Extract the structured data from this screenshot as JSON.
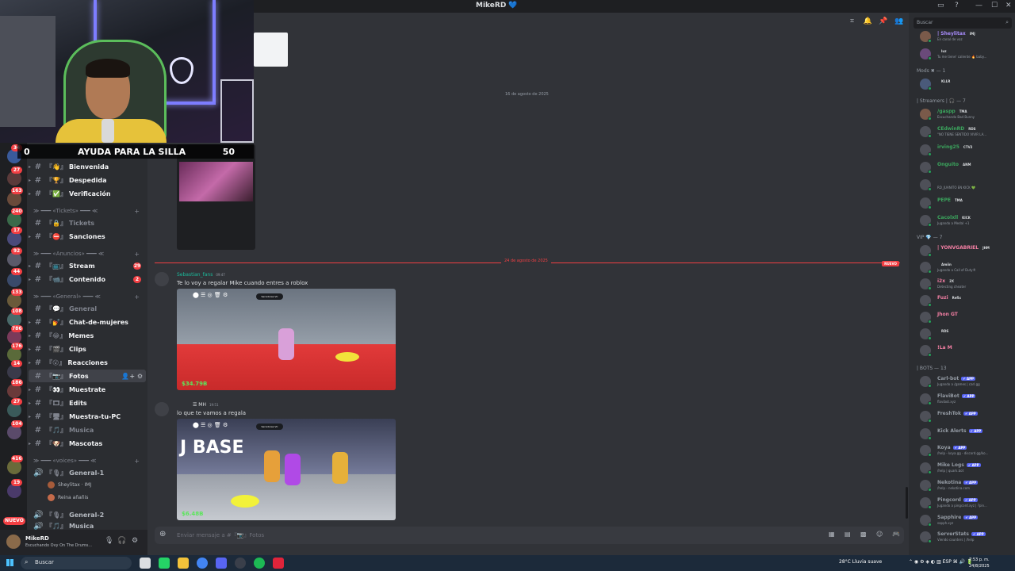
{
  "window": {
    "title": "MikeRD",
    "heart": "💙",
    "controls": [
      "▭",
      "?",
      "—",
      "☐",
      "✕"
    ]
  },
  "overlay": {
    "left_count": "0",
    "goal_text": "AYUDA PARA LA SILLA",
    "right_count": "50"
  },
  "rail": {
    "badges": [
      "34",
      "27",
      "163",
      "240",
      "17",
      "92",
      "44",
      "133",
      "108",
      "786",
      "176",
      "14",
      "186",
      "27",
      "104",
      "416",
      "19"
    ],
    "nuevo": "NUEVO"
  },
  "sidebar": {
    "channels": [
      {
        "label": "Bienvenida",
        "deco": "『👋』",
        "muted": false
      },
      {
        "label": "Despedida",
        "deco": "『🏆』",
        "muted": false
      },
      {
        "label": "Verificación",
        "deco": "『✅』",
        "muted": false
      },
      {
        "label": "Tickets",
        "deco": "『🔒』",
        "muted": true
      },
      {
        "label": "Sanciones",
        "deco": "『⛔』",
        "muted": false
      },
      {
        "label": "Stream",
        "deco": "『📺』",
        "muted": false,
        "badge": "29"
      },
      {
        "label": "Contenido",
        "deco": "『📹』",
        "muted": false,
        "badge": "2"
      },
      {
        "label": "General",
        "deco": "『💬』",
        "muted": true
      },
      {
        "label": "Chat-de-mujeres",
        "deco": "『💅』",
        "muted": false
      },
      {
        "label": "Memes",
        "deco": "『😂』",
        "muted": false
      },
      {
        "label": "Clips",
        "deco": "『🎬』",
        "muted": false
      },
      {
        "label": "Reacciones",
        "deco": "『😮』",
        "muted": false
      },
      {
        "label": "Fotos",
        "deco": "『📷』",
        "muted": false,
        "active": true
      },
      {
        "label": "Muestrate",
        "deco": "『👀』",
        "muted": false
      },
      {
        "label": "Edits",
        "deco": "『🎞』",
        "muted": false
      },
      {
        "label": "Muestra-tu-PC",
        "deco": "『🖥』",
        "muted": false
      },
      {
        "label": "Musica",
        "deco": "『🎵』",
        "muted": true
      },
      {
        "label": "Mascotas",
        "deco": "『🐶』",
        "muted": false
      }
    ],
    "categories": {
      "tickets": "≫ ━━━ «Tickets» ━━━ ≪",
      "anuncios": "≫ ━━━ «Anuncios» ━━━ ≪",
      "general": "≫ ━━━ «General» ━━━ ≪",
      "voices": "≫ ━━━ «voices» ━━━ ≪"
    },
    "voice": {
      "general1": "General-1",
      "user1": "Sheylitax",
      "user1_tag": "IMJ",
      "user2": "Reina añañis",
      "general2": "General-2",
      "musica": "Musica"
    }
  },
  "user_panel": {
    "name": "MikeRD",
    "status": "Escuchando Ovy On The Drums..."
  },
  "chat": {
    "date_top": "16 de agosto de 2025",
    "date_new": "24 de agosto de 2025",
    "new_label": "NUEVO",
    "msg1": {
      "author": "Sebastian_fans",
      "time": "09:47",
      "text": "Te lo voy a regalar Mike cuando entres a roblox"
    },
    "shot1": {
      "tag": "Servidores VC",
      "money": "$34.79B"
    },
    "msg2": {
      "author": "☰ MH",
      "time": "19:51",
      "text": "lo que te vamos a regala"
    },
    "shot2": {
      "tag": "Servidores VC",
      "money": "$6.48B",
      "title": "J BASE"
    },
    "composer_placeholder": "Enviar mensaje a #『📷』Fotos"
  },
  "members": {
    "search_placeholder": "Buscar",
    "groups": {
      "mods": "Mods ✖ — 1",
      "streamers": "| Streamers | 🎧 — 7",
      "vip": "VIP 💎 — 7",
      "bots": "| BOTS — 13"
    },
    "top": [
      {
        "name": "| Sheylitax",
        "status": "En canal de voz",
        "color": "#a78bfa",
        "tag": "IMJ"
      },
      {
        "name": "",
        "status": "Tu me tiene' caliente 🔥 baby...",
        "color": "#dbdee1",
        "tag": "luz"
      }
    ],
    "mods": [
      {
        "name": "",
        "status": "",
        "color": "#5865f2",
        "tag": "KLLR"
      }
    ],
    "streamers": [
      {
        "name": "/gaspp",
        "status": "Escuchando Bad Bunny",
        "color": "#3ba55d",
        "tag": "TMA"
      },
      {
        "name": "CEdwinRD",
        "status": "\"NO TIENE SENTIDO VIVIR LA...",
        "color": "#3ba55d",
        "tag": "RDS"
      },
      {
        "name": "irving25",
        "status": "",
        "color": "#3ba55d",
        "tag": "CTV2"
      },
      {
        "name": "Onguito",
        "status": "",
        "color": "#3ba55d",
        "tag": "ANM"
      },
      {
        "name": "",
        "status": "RD_JUANITO EN KICK 💚",
        "color": "#3ba55d",
        "tag": ""
      },
      {
        "name": "PEPE",
        "status": "",
        "color": "#3ba55d",
        "tag": "TMA"
      },
      {
        "name": "Cacolxll",
        "status": "Jugando a Medal +1",
        "color": "#3ba55d",
        "tag": "KICK"
      }
    ],
    "vip": [
      {
        "name": "| YONVGABRIEL",
        "status": "",
        "color": "#f47fa4",
        "tag": "JHM"
      },
      {
        "name": "",
        "status": "Jugando a Call of Duty®",
        "color": "#f23f43",
        "tag": "Amiin"
      },
      {
        "name": "i2x",
        "status": "Detecting cheater",
        "color": "#f47fa4",
        "tag": "2X"
      },
      {
        "name": "Fuzi",
        "status": "",
        "color": "#f47fa4",
        "tag": "Refix"
      },
      {
        "name": "Jhon GT",
        "status": "",
        "color": "#f47fa4",
        "tag": ""
      },
      {
        "name": "",
        "status": "",
        "color": "#f47fa4",
        "tag": "RDS"
      },
      {
        "name": "!La M",
        "status": "",
        "color": "#f47fa4",
        "tag": ""
      }
    ],
    "bots": [
      {
        "name": "Carl-bot",
        "status": "Jugando a /games | carl.gg",
        "color": "#949ba4",
        "tag": "✔ APP"
      },
      {
        "name": "FlaviBot",
        "status": "flavibot.xyz",
        "color": "#949ba4",
        "tag": "✔ APP"
      },
      {
        "name": "FreshTok",
        "status": "",
        "color": "#949ba4",
        "tag": "✔ APP"
      },
      {
        "name": "Kick Alerts",
        "status": "",
        "color": "#949ba4",
        "tag": "✔ APP"
      },
      {
        "name": "Koya",
        "status": "/help - koya.gg - discord.gg/ko...",
        "color": "#949ba4",
        "tag": "✔ APP"
      },
      {
        "name": "Mike Logs",
        "status": "/help | quark.bot",
        "color": "#949ba4",
        "tag": "✔ APP"
      },
      {
        "name": "Nekotina",
        "status": "/help - nekotina.com",
        "color": "#949ba4",
        "tag": "✔ APP"
      },
      {
        "name": "Pingcord",
        "status": "Jugando a pingcord.xyz | ?pin...",
        "color": "#949ba4",
        "tag": "✔ APP"
      },
      {
        "name": "Sapphire",
        "status": "sapph.xyz",
        "color": "#949ba4",
        "tag": "✔ APP"
      },
      {
        "name": "ServerStats",
        "status": "Viendo counters | /help",
        "color": "#949ba4",
        "tag": "✔ APP"
      }
    ]
  },
  "taskbar": {
    "search_placeholder": "Buscar",
    "weather": "28°C  Lluvia suave",
    "lang": "ESP",
    "time": "7:53 p. m.",
    "date": "24/8/2025"
  },
  "colors": {
    "accent": "#5865f2",
    "danger": "#f23f43",
    "online": "#23a55a"
  }
}
